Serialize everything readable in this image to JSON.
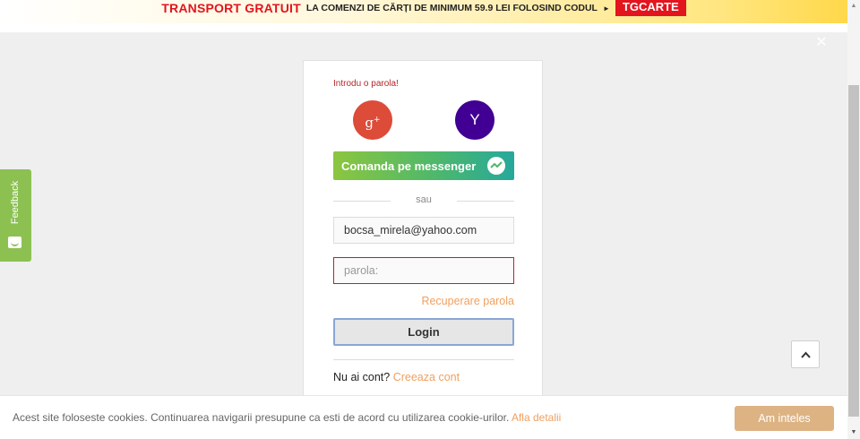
{
  "promo": {
    "bold_text": "TRANSPORT GRATUIT",
    "text": "LA COMENZI DE CĂRȚI DE MINIMUM 59.9 LEI FOLOSIND CODUL",
    "arrow": "►",
    "code": "TGCARTE"
  },
  "overlay": {
    "close_icon": "✕"
  },
  "feedback": {
    "label": "Feedback"
  },
  "login": {
    "error": "Introdu o parola!",
    "google_label": "g+",
    "yahoo_label": "Y",
    "messenger_label": "Comanda pe messenger",
    "divider_text": "sau",
    "email_value": "bocsa_mirela@yahoo.com",
    "password_placeholder": "parola:",
    "recover_label": "Recuperare parola",
    "login_label": "Login",
    "no_account_text": "Nu ai cont?",
    "create_account_label": "Creeaza cont"
  },
  "cookie": {
    "text": "Acest site foloseste cookies. Continuarea navigarii presupune ca esti de acord cu utilizarea cookie-urilor.",
    "link_label": "Afla detalii",
    "accept_label": "Am inteles"
  },
  "colors": {
    "promo_red": "#e3141d",
    "google": "#dd4b39",
    "yahoo": "#410093",
    "feedback_green": "#8cc152",
    "link_orange": "#f0a060",
    "cookie_button": "#ddb383"
  },
  "icons": {
    "overlay_close": "close-icon",
    "messenger": "messenger-icon",
    "back_to_top": "chevron-up-icon",
    "feedback": "feedback-smile-icon"
  }
}
